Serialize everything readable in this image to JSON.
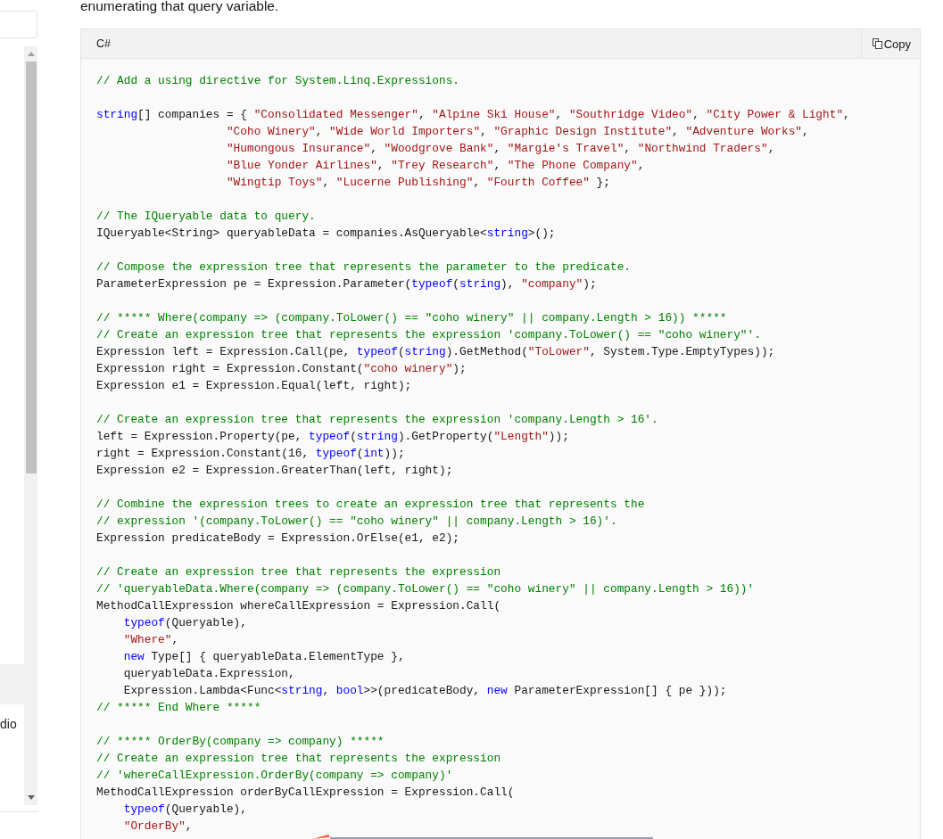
{
  "sidebar": {
    "items": [
      {
        "selected": true
      },
      {
        "label": "dio",
        "selected": false
      }
    ]
  },
  "intro": "enumerating that query variable.",
  "code_block": {
    "language": "C#",
    "copy_label": "Copy",
    "blocks": [
      [
        [
          {
            "kind": "comment",
            "text": "// Add a using directive for System.Linq.Expressions."
          }
        ]
      ],
      [
        [
          {
            "kind": "keyword",
            "text": "string"
          },
          {
            "kind": "plain",
            "text": "[] companies = { "
          },
          {
            "kind": "string",
            "text": "\"Consolidated Messenger\""
          },
          {
            "kind": "plain",
            "text": ", "
          },
          {
            "kind": "string",
            "text": "\"Alpine Ski House\""
          },
          {
            "kind": "plain",
            "text": ", "
          },
          {
            "kind": "string",
            "text": "\"Southridge Video\""
          },
          {
            "kind": "plain",
            "text": ", "
          },
          {
            "kind": "string",
            "text": "\"City Power & Light\""
          },
          {
            "kind": "plain",
            "text": ","
          }
        ],
        [
          {
            "kind": "string",
            "text": "                   \"Coho Winery\""
          },
          {
            "kind": "plain",
            "text": ", "
          },
          {
            "kind": "string",
            "text": "\"Wide World Importers\""
          },
          {
            "kind": "plain",
            "text": ", "
          },
          {
            "kind": "string",
            "text": "\"Graphic Design Institute\""
          },
          {
            "kind": "plain",
            "text": ", "
          },
          {
            "kind": "string",
            "text": "\"Adventure Works\""
          },
          {
            "kind": "plain",
            "text": ","
          }
        ],
        [
          {
            "kind": "string",
            "text": "                   \"Humongous Insurance\""
          },
          {
            "kind": "plain",
            "text": ", "
          },
          {
            "kind": "string",
            "text": "\"Woodgrove Bank\""
          },
          {
            "kind": "plain",
            "text": ", "
          },
          {
            "kind": "string",
            "text": "\"Margie's Travel\""
          },
          {
            "kind": "plain",
            "text": ", "
          },
          {
            "kind": "string",
            "text": "\"Northwind Traders\""
          },
          {
            "kind": "plain",
            "text": ","
          }
        ],
        [
          {
            "kind": "string",
            "text": "                   \"Blue Yonder Airlines\""
          },
          {
            "kind": "plain",
            "text": ", "
          },
          {
            "kind": "string",
            "text": "\"Trey Research\""
          },
          {
            "kind": "plain",
            "text": ", "
          },
          {
            "kind": "string",
            "text": "\"The Phone Company\""
          },
          {
            "kind": "plain",
            "text": ","
          }
        ],
        [
          {
            "kind": "string",
            "text": "                   \"Wingtip Toys\""
          },
          {
            "kind": "plain",
            "text": ", "
          },
          {
            "kind": "string",
            "text": "\"Lucerne Publishing\""
          },
          {
            "kind": "plain",
            "text": ", "
          },
          {
            "kind": "string",
            "text": "\"Fourth Coffee\""
          },
          {
            "kind": "plain",
            "text": " };"
          }
        ]
      ],
      [
        [
          {
            "kind": "comment",
            "text": "// The IQueryable data to query."
          }
        ],
        [
          {
            "kind": "plain",
            "text": "IQueryable<String> queryableData = companies.AsQueryable<"
          },
          {
            "kind": "keyword",
            "text": "string"
          },
          {
            "kind": "plain",
            "text": ">();"
          }
        ]
      ],
      [
        [
          {
            "kind": "comment",
            "text": "// Compose the expression tree that represents the parameter to the predicate."
          }
        ],
        [
          {
            "kind": "plain",
            "text": "ParameterExpression pe = Expression.Parameter("
          },
          {
            "kind": "keyword",
            "text": "typeof"
          },
          {
            "kind": "plain",
            "text": "("
          },
          {
            "kind": "keyword",
            "text": "string"
          },
          {
            "kind": "plain",
            "text": "), "
          },
          {
            "kind": "string",
            "text": "\"company\""
          },
          {
            "kind": "plain",
            "text": ");"
          }
        ]
      ],
      [
        [
          {
            "kind": "comment",
            "text": "// ***** Where(company => (company.ToLower() == \"coho winery\" || company.Length > 16)) *****"
          }
        ],
        [
          {
            "kind": "comment",
            "text": "// Create an expression tree that represents the expression 'company.ToLower() == \"coho winery\"'."
          }
        ],
        [
          {
            "kind": "plain",
            "text": "Expression left = Expression.Call(pe, "
          },
          {
            "kind": "keyword",
            "text": "typeof"
          },
          {
            "kind": "plain",
            "text": "("
          },
          {
            "kind": "keyword",
            "text": "string"
          },
          {
            "kind": "plain",
            "text": ").GetMethod("
          },
          {
            "kind": "string",
            "text": "\"ToLower\""
          },
          {
            "kind": "plain",
            "text": ", System.Type.EmptyTypes));"
          }
        ],
        [
          {
            "kind": "plain",
            "text": "Expression right = Expression.Constant("
          },
          {
            "kind": "string",
            "text": "\"coho winery\""
          },
          {
            "kind": "plain",
            "text": ");"
          }
        ],
        [
          {
            "kind": "plain",
            "text": "Expression e1 = Expression.Equal(left, right);"
          }
        ]
      ],
      [
        [
          {
            "kind": "comment",
            "text": "// Create an expression tree that represents the expression 'company.Length > 16'."
          }
        ],
        [
          {
            "kind": "plain",
            "text": "left = Expression.Property(pe, "
          },
          {
            "kind": "keyword",
            "text": "typeof"
          },
          {
            "kind": "plain",
            "text": "("
          },
          {
            "kind": "keyword",
            "text": "string"
          },
          {
            "kind": "plain",
            "text": ").GetProperty("
          },
          {
            "kind": "string",
            "text": "\"Length\""
          },
          {
            "kind": "plain",
            "text": "));"
          }
        ],
        [
          {
            "kind": "plain",
            "text": "right = Expression.Constant(16, "
          },
          {
            "kind": "keyword",
            "text": "typeof"
          },
          {
            "kind": "plain",
            "text": "("
          },
          {
            "kind": "keyword",
            "text": "int"
          },
          {
            "kind": "plain",
            "text": "));"
          }
        ],
        [
          {
            "kind": "plain",
            "text": "Expression e2 = Expression.GreaterThan(left, right);"
          }
        ]
      ],
      [
        [
          {
            "kind": "comment",
            "text": "// Combine the expression trees to create an expression tree that represents the"
          }
        ],
        [
          {
            "kind": "comment",
            "text": "// expression '(company.ToLower() == \"coho winery\" || company.Length > 16)'."
          }
        ],
        [
          {
            "kind": "plain",
            "text": "Expression predicateBody = Expression.OrElse(e1, e2);"
          }
        ]
      ],
      [
        [
          {
            "kind": "comment",
            "text": "// Create an expression tree that represents the expression"
          }
        ],
        [
          {
            "kind": "comment",
            "text": "// 'queryableData.Where(company => (company.ToLower() == \"coho winery\" || company.Length > 16))'"
          }
        ],
        [
          {
            "kind": "plain",
            "text": "MethodCallExpression whereCallExpression = Expression.Call("
          }
        ],
        [
          {
            "kind": "keyword",
            "text": "    typeof"
          },
          {
            "kind": "plain",
            "text": "(Queryable),"
          }
        ],
        [
          {
            "kind": "string",
            "text": "    \"Where\""
          },
          {
            "kind": "plain",
            "text": ","
          }
        ],
        [
          {
            "kind": "keyword",
            "text": "    new"
          },
          {
            "kind": "plain",
            "text": " Type[] { queryableData.ElementType },"
          }
        ],
        [
          {
            "kind": "plain",
            "text": "    queryableData.Expression,"
          }
        ],
        [
          {
            "kind": "plain",
            "text": "    Expression.Lambda<Func<"
          },
          {
            "kind": "keyword",
            "text": "string"
          },
          {
            "kind": "plain",
            "text": ", "
          },
          {
            "kind": "keyword",
            "text": "bool"
          },
          {
            "kind": "plain",
            "text": ">>(predicateBody, "
          },
          {
            "kind": "keyword",
            "text": "new"
          },
          {
            "kind": "plain",
            "text": " ParameterExpression[] { pe }));"
          }
        ],
        [
          {
            "kind": "comment",
            "text": "// ***** End Where *****"
          }
        ]
      ],
      [
        [
          {
            "kind": "comment",
            "text": "// ***** OrderBy(company => company) *****"
          }
        ],
        [
          {
            "kind": "comment",
            "text": "// Create an expression tree that represents the expression"
          }
        ],
        [
          {
            "kind": "comment",
            "text": "// 'whereCallExpression.OrderBy(company => company)'"
          }
        ],
        [
          {
            "kind": "plain",
            "text": "MethodCallExpression orderByCallExpression = Expression.Call("
          }
        ],
        [
          {
            "kind": "keyword",
            "text": "    typeof"
          },
          {
            "kind": "plain",
            "text": "(Queryable),"
          }
        ],
        [
          {
            "kind": "string",
            "text": "    \"OrderBy\""
          },
          {
            "kind": "plain",
            "text": ","
          }
        ]
      ]
    ]
  }
}
